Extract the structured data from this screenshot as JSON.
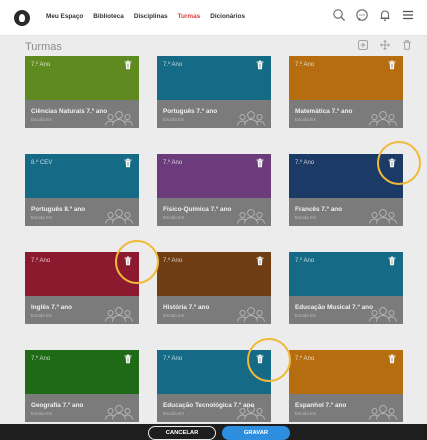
{
  "nav": {
    "items": [
      "Meu Espaço",
      "Biblioteca",
      "Disciplinas",
      "Turmas",
      "Dicionários"
    ],
    "active": "Turmas",
    "accent_color": "#e0383c"
  },
  "page": {
    "title": "Turmas"
  },
  "cards": [
    {
      "year": "7.º Ano",
      "name": "Ciências Naturais 7.º ano",
      "sub": "Escola EX",
      "color": "#5f8a1f"
    },
    {
      "year": "7.º Ano",
      "name": "Português 7.º ano",
      "sub": "Escola EX",
      "color": "#156a86"
    },
    {
      "year": "7.º Ano",
      "name": "Matemática 7.º ano",
      "sub": "Escola EX",
      "color": "#b56d10"
    },
    {
      "year": "8.º CEV",
      "name": "Português 8.º ano",
      "sub": "Escola EX",
      "color": "#156a86"
    },
    {
      "year": "7.º Ano",
      "name": "Físico-Química 7.º ano",
      "sub": "Escola EX",
      "color": "#6b3b7c"
    },
    {
      "year": "7.º Ano",
      "name": "Francês 7.º ano",
      "sub": "Escola EX",
      "color": "#1b3b66"
    },
    {
      "year": "7.º Ano",
      "name": "Inglês 7.º ano",
      "sub": "Escola EX",
      "color": "#8c1a2e"
    },
    {
      "year": "7.º Ano",
      "name": "História 7.º ano",
      "sub": "Escola EX",
      "color": "#6e3d13"
    },
    {
      "year": "7.º Ano",
      "name": "Educação Musical 7.º ano",
      "sub": "Escola EX",
      "color": "#156a86"
    },
    {
      "year": "7.º Ano",
      "name": "Geografia 7.º ano",
      "sub": "Escola EX",
      "color": "#1f6a16"
    },
    {
      "year": "7.º Ano",
      "name": "Educação Tecnológica 7.º ano",
      "sub": "Escola EX",
      "color": "#156a86"
    },
    {
      "year": "7.º Ano",
      "name": "Espanhol 7.º ano",
      "sub": "Escola EX",
      "color": "#b56d10"
    }
  ],
  "icons": {
    "navbar": [
      "search-icon",
      "chat-icon",
      "bell-icon",
      "menu-icon"
    ],
    "page_tools": [
      "add-icon",
      "move-icon",
      "delete-icon"
    ],
    "card": [
      "trash-icon",
      "people-icon"
    ]
  },
  "footer": {
    "cancel_label": "CANCELAR",
    "save_label": "GRAVAR",
    "save_color": "#2d8ee0"
  }
}
